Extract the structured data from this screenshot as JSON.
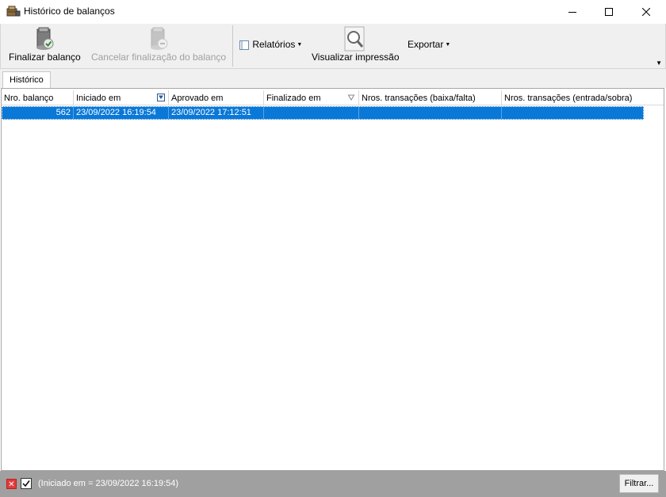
{
  "window": {
    "title": "Histórico de balanços"
  },
  "toolbar": {
    "finalize_label": "Finalizar balanço",
    "cancel_finalize_label": "Cancelar finalização do balanço",
    "reports_label": "Relatórios",
    "print_preview_label": "Visualizar impressão",
    "export_label": "Exportar"
  },
  "tabs": [
    {
      "label": "Histórico"
    }
  ],
  "grid": {
    "columns": [
      "Nro. balanço",
      "Iniciado em",
      "Aprovado em",
      "Finalizado em",
      "Nros. transações (baixa/falta)",
      "Nros. transações (entrada/sobra)"
    ],
    "rows": [
      {
        "nro": "562",
        "iniciado": "23/09/2022 16:19:54",
        "aprovado": "23/09/2022 17:12:51",
        "finalizado": "",
        "baixa_falta": "",
        "entrada_sobra": ""
      }
    ]
  },
  "filter_bar": {
    "expression": "(Iniciado em = 23/09/2022 16:19:54)",
    "filter_button": "Filtrar..."
  },
  "colors": {
    "selection": "#0a78d7",
    "filter_bar": "#a0a0a0",
    "clear_filter": "#e23b3b"
  }
}
